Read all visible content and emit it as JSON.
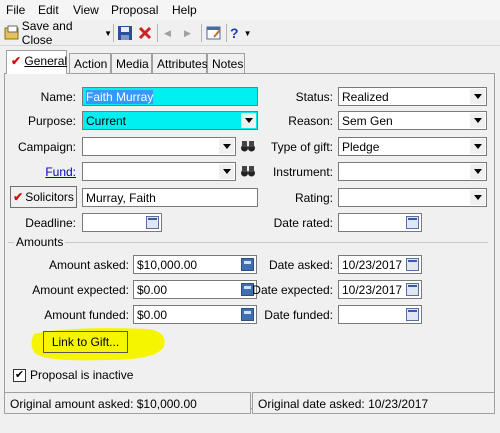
{
  "menu": [
    "File",
    "Edit",
    "View",
    "Proposal",
    "Help"
  ],
  "toolbar": {
    "save_close_label": "Save and Close"
  },
  "tabs": [
    "General",
    "Action",
    "Media",
    "Attributes",
    "Notes"
  ],
  "left": {
    "name_label": "Name:",
    "name_value": "Faith Murray",
    "purpose_label": "Purpose:",
    "purpose_value": "Current",
    "campaign_label": "Campaign:",
    "campaign_value": "",
    "fund_label": "Fund:",
    "fund_value": "",
    "solicitors_label": "Solicitors",
    "solicitors_value": "Murray, Faith",
    "deadline_label": "Deadline:",
    "deadline_value": ""
  },
  "right": {
    "status_label": "Status:",
    "status_value": "Realized",
    "reason_label": "Reason:",
    "reason_value": "Sem Gen",
    "type_label": "Type of gift:",
    "type_value": "Pledge",
    "instrument_label": "Instrument:",
    "instrument_value": "",
    "rating_label": "Rating:",
    "rating_value": "",
    "date_rated_label": "Date rated:",
    "date_rated_value": ""
  },
  "amounts": {
    "group_label": "Amounts",
    "asked_label": "Amount asked:",
    "asked_value": "$10,000.00",
    "expected_label": "Amount expected:",
    "expected_value": "$0.00",
    "funded_label": "Amount funded:",
    "funded_value": "$0.00",
    "date_asked_label": "Date asked:",
    "date_asked_value": "10/23/2017",
    "date_expected_label": "Date expected:",
    "date_expected_value": "10/23/2017",
    "date_funded_label": "Date funded:",
    "date_funded_value": ""
  },
  "link_gift_label": "Link to Gift...",
  "inactive_label": "Proposal is inactive",
  "inactive_checked": true,
  "status": {
    "original_amount": "Original amount asked: $10,000.00",
    "original_date": "Original date asked: 10/23/2017"
  },
  "colors": {
    "highlight_field": "#00f0f0",
    "marker": "#f5f500",
    "link": "#0000cc"
  }
}
